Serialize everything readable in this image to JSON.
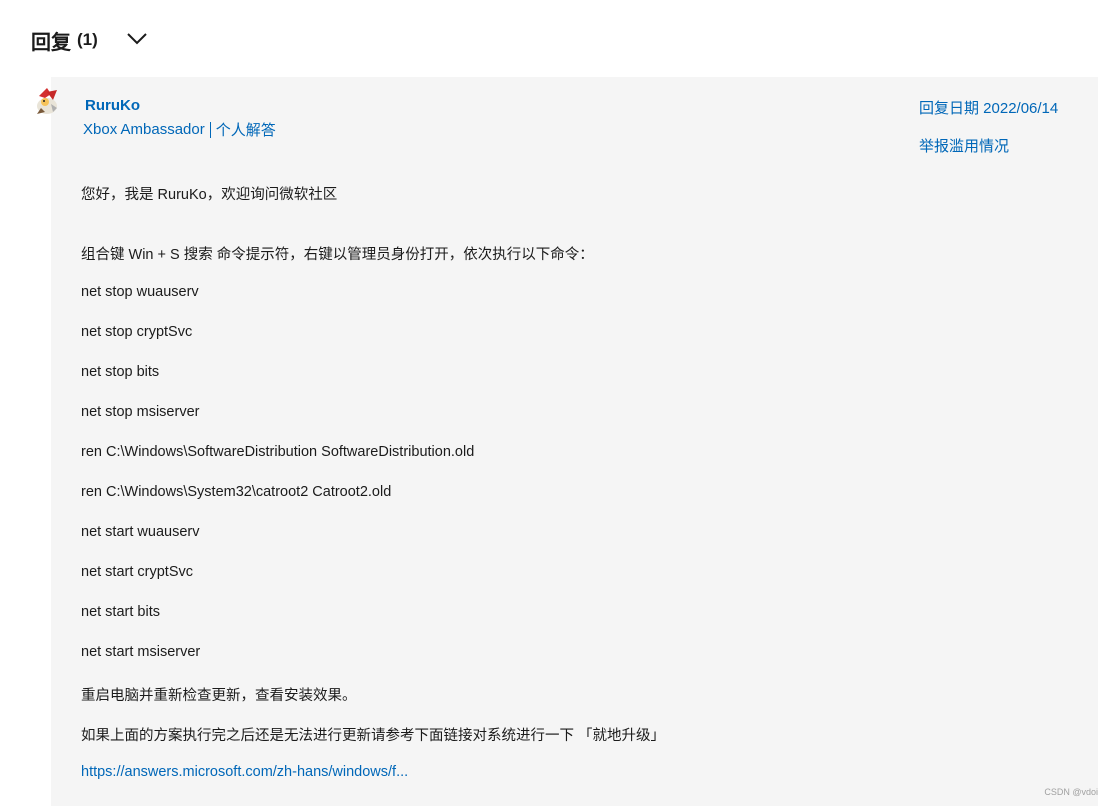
{
  "section": {
    "title": "回复",
    "count": "(1)"
  },
  "icons": {
    "collapse": "chevron-down-icon",
    "avatar": "avatar-image"
  },
  "colors": {
    "link": "#0067b8",
    "card_bg": "#f5f5f5",
    "text": "#1b1b1b"
  },
  "reply": {
    "author": "RuruKo",
    "role": "Xbox Ambassador",
    "tag": "个人解答",
    "date": "回复日期 2022/06/14",
    "report": "举报滥用情况",
    "lines": [
      "您好，我是 RuruKo，欢迎询问微软社区",
      "组合键 Win + S 搜索 命令提示符，右键以管理员身份打开，依次执行以下命令：",
      "net stop wuauserv",
      "net stop cryptSvc",
      "net stop bits",
      "net stop msiserver",
      "ren C:\\Windows\\SoftwareDistribution SoftwareDistribution.old",
      "ren C:\\Windows\\System32\\catroot2 Catroot2.old",
      "net start wuauserv",
      "net start cryptSvc",
      "net start bits",
      "net start msiserver",
      "重启电脑并重新检查更新，查看安装效果。",
      "如果上面的方案执行完之后还是无法进行更新请参考下面链接对系统进行一下 「就地升级」"
    ],
    "link": "https://answers.microsoft.com/zh-hans/windows/f..."
  },
  "watermark": "CSDN @vdoi"
}
